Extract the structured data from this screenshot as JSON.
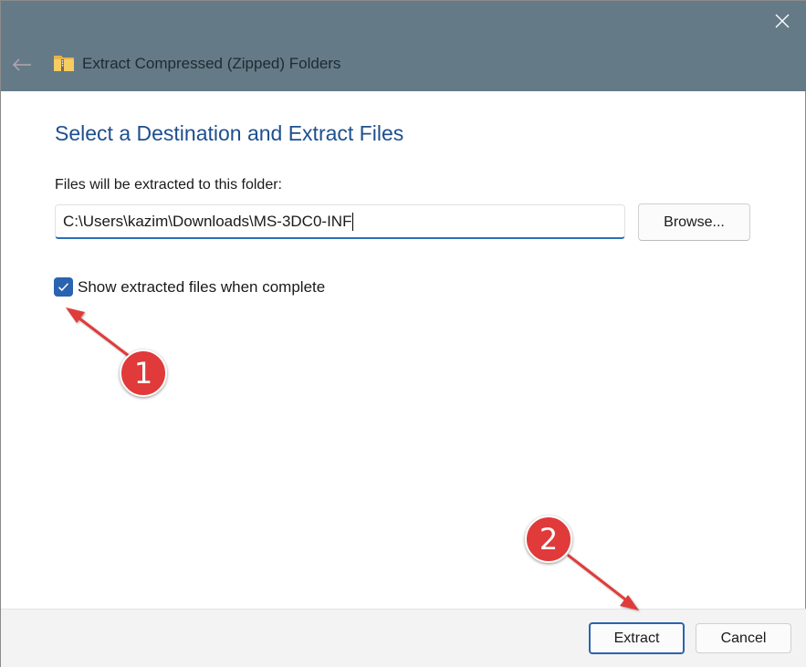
{
  "window": {
    "title": "Extract Compressed (Zipped) Folders",
    "icons": {
      "back": "back-arrow-icon",
      "close": "close-icon",
      "folder": "zipped-folder-icon"
    }
  },
  "main": {
    "heading": "Select a Destination and Extract Files",
    "destination_label": "Files will be extracted to this folder:",
    "destination_path": "C:\\Users\\kazim\\Downloads\\MS-3DC0-INF",
    "browse_label": "Browse...",
    "show_files_checkbox": {
      "label": "Show extracted files when complete",
      "checked": true
    }
  },
  "footer": {
    "extract_label": "Extract",
    "cancel_label": "Cancel"
  },
  "annotations": {
    "step1": "1",
    "step2": "2"
  },
  "colors": {
    "titlebar": "#647a87",
    "heading": "#1e4f8f",
    "accent": "#2a63b0",
    "annotation": "#e03a3a"
  }
}
